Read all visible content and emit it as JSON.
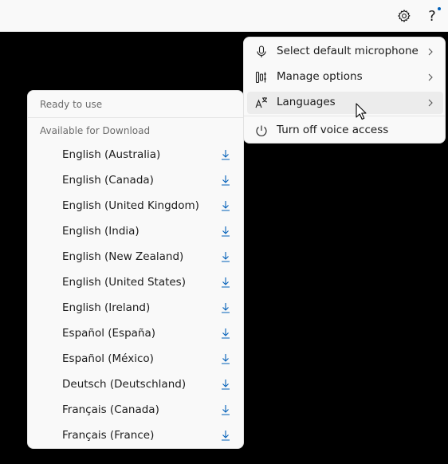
{
  "toolbar": {
    "settings_icon": "gear-icon",
    "help_label": "?",
    "notification_color": "#005fb8"
  },
  "menu": {
    "items": [
      {
        "label": "Select default microphone",
        "icon": "microphone-icon",
        "has_submenu": true
      },
      {
        "label": "Manage options",
        "icon": "options-icon",
        "has_submenu": true
      },
      {
        "label": "Languages",
        "icon": "language-icon",
        "has_submenu": true,
        "hovered": true
      },
      {
        "label": "Turn off voice access",
        "icon": "power-icon",
        "has_submenu": false
      }
    ]
  },
  "languages": {
    "ready_header": "Ready to use",
    "download_header": "Available for Download",
    "download_icon": "download-icon",
    "accent_color": "#005fb8",
    "items": [
      {
        "label": "English (Australia)"
      },
      {
        "label": "English (Canada)"
      },
      {
        "label": "English (United Kingdom)"
      },
      {
        "label": "English (India)"
      },
      {
        "label": "English (New Zealand)"
      },
      {
        "label": "English (United States)"
      },
      {
        "label": "English (Ireland)"
      },
      {
        "label": "Español (España)"
      },
      {
        "label": "Español (México)"
      },
      {
        "label": "Deutsch (Deutschland)"
      },
      {
        "label": "Français (Canada)"
      },
      {
        "label": "Français (France)"
      }
    ]
  }
}
